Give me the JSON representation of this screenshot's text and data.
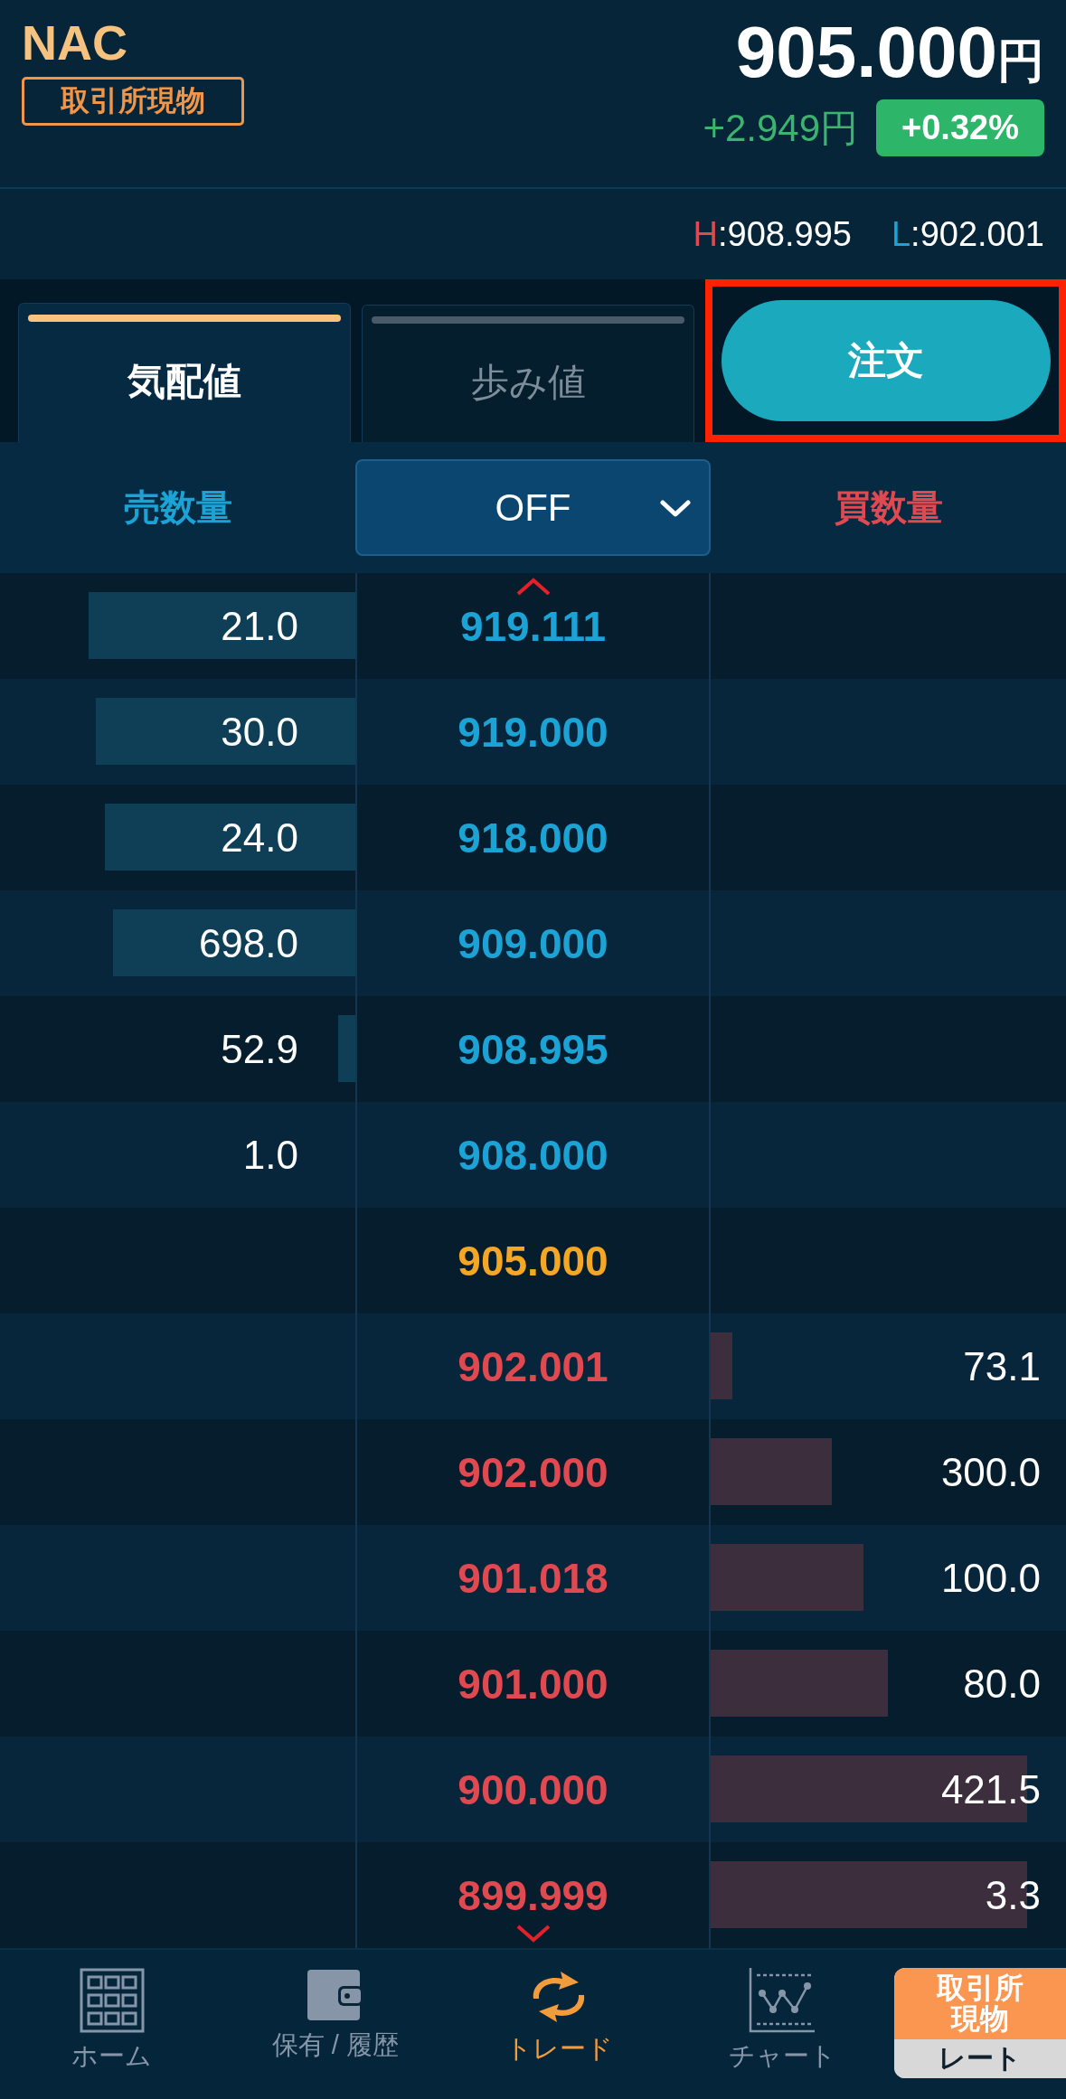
{
  "header": {
    "symbol": "NAC",
    "market_badge": "取引所現物",
    "price": "905.000",
    "price_unit": "円",
    "change": "+2.949円",
    "change_pct": "+0.32%"
  },
  "high_low": {
    "high_label": "H",
    "high": ":908.995",
    "low_label": "L",
    "low": ":902.001"
  },
  "tabs": [
    {
      "label": "気配値",
      "selected": true
    },
    {
      "label": "歩み値",
      "selected": false
    }
  ],
  "order_button": {
    "label": "注文",
    "highlighted": true
  },
  "columns": {
    "sell": "売数量",
    "filter": "OFF",
    "buy": "買数量"
  },
  "rows": [
    {
      "kind": "ask",
      "price": "919.111",
      "qty": "21.0"
    },
    {
      "kind": "ask",
      "price": "919.000",
      "qty": "30.0"
    },
    {
      "kind": "ask",
      "price": "918.000",
      "qty": "24.0"
    },
    {
      "kind": "ask",
      "price": "909.000",
      "qty": "698.0"
    },
    {
      "kind": "ask",
      "price": "908.995",
      "qty": "52.9"
    },
    {
      "kind": "ask",
      "price": "908.000",
      "qty": "1.0"
    },
    {
      "kind": "last",
      "price": "905.000"
    },
    {
      "kind": "bid",
      "price": "902.001",
      "qty": "73.1"
    },
    {
      "kind": "bid",
      "price": "902.000",
      "qty": "300.0"
    },
    {
      "kind": "bid",
      "price": "901.018",
      "qty": "100.0"
    },
    {
      "kind": "bid",
      "price": "901.000",
      "qty": "80.0"
    },
    {
      "kind": "bid",
      "price": "900.000",
      "qty": "421.5"
    },
    {
      "kind": "bid",
      "price": "899.999",
      "qty": "3.3"
    }
  ],
  "nav": [
    {
      "kind": "grid",
      "label": "ホーム",
      "selected": false
    },
    {
      "kind": "wallet",
      "label": "保有 / 履歴",
      "selected": false
    },
    {
      "kind": "trade",
      "label": "トレード",
      "selected": true
    },
    {
      "kind": "chart",
      "label": "チャート",
      "selected": false
    }
  ],
  "rate_badge": {
    "top": "取引所現物",
    "bottom": "レート"
  }
}
